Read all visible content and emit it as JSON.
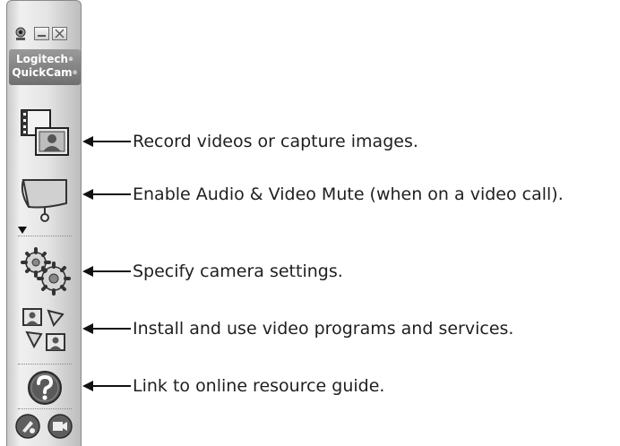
{
  "toolbar": {
    "brand_line1": "Logitech",
    "brand_line2": "QuickCam",
    "registered_mark": "®"
  },
  "callouts": [
    {
      "text": "Record videos or capture images."
    },
    {
      "text": "Enable Audio & Video Mute (when on a video call)."
    },
    {
      "text": "Specify camera settings."
    },
    {
      "text": "Install and use video programs and services."
    },
    {
      "text": "Link to online resource guide."
    }
  ],
  "icons": {
    "record": "video-capture-icon",
    "mute": "audio-video-mute-icon",
    "settings": "gears-icon",
    "programs": "video-services-icon",
    "help": "help-question-icon",
    "bottom_left": "effects-icon",
    "bottom_right": "video-camera-icon"
  },
  "colors": {
    "toolbar_bg": "#e4e4e4",
    "brand_bg": "#7f7f7f",
    "text": "#1f1f1f"
  }
}
